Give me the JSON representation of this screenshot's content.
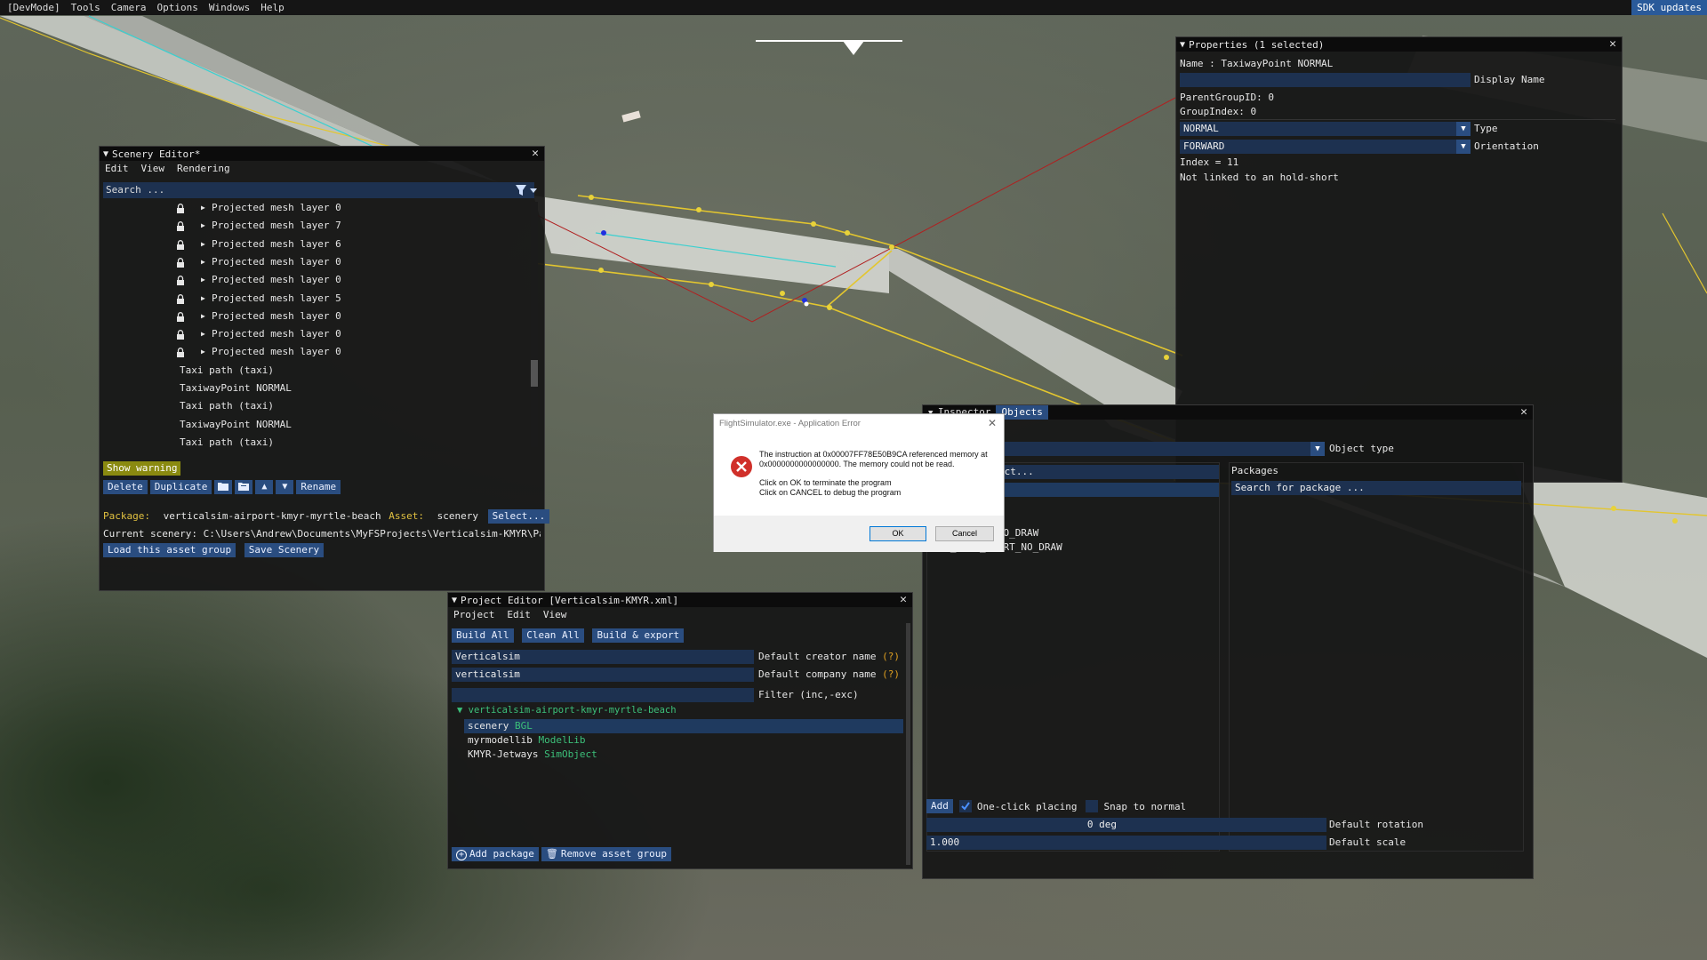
{
  "menubar": {
    "items": [
      "[DevMode]",
      "Tools",
      "Camera",
      "Options",
      "Windows",
      "Help"
    ],
    "sdk_updates": "SDK updates"
  },
  "scenery_editor": {
    "title": "Scenery Editor*",
    "menu": [
      "Edit",
      "View",
      "Rendering"
    ],
    "search_placeholder": "Search ...",
    "items": [
      {
        "label": "Projected mesh layer 0",
        "locked": true,
        "expandable": true
      },
      {
        "label": "Projected mesh layer 7",
        "locked": true,
        "expandable": true
      },
      {
        "label": "Projected mesh layer 6",
        "locked": true,
        "expandable": true
      },
      {
        "label": "Projected mesh layer 0",
        "locked": true,
        "expandable": true
      },
      {
        "label": "Projected mesh layer 0",
        "locked": true,
        "expandable": true
      },
      {
        "label": "Projected mesh layer 5",
        "locked": true,
        "expandable": true
      },
      {
        "label": "Projected mesh layer 0",
        "locked": true,
        "expandable": true
      },
      {
        "label": "Projected mesh layer 0",
        "locked": true,
        "expandable": true
      },
      {
        "label": "Projected mesh layer 0",
        "locked": true,
        "expandable": true
      },
      {
        "label": "Taxi path  (taxi)",
        "locked": false,
        "expandable": false
      },
      {
        "label": "TaxiwayPoint NORMAL",
        "locked": false,
        "expandable": false
      },
      {
        "label": "Taxi path  (taxi)",
        "locked": false,
        "expandable": false
      },
      {
        "label": "TaxiwayPoint NORMAL",
        "locked": false,
        "expandable": false
      },
      {
        "label": "Taxi path  (taxi)",
        "locked": false,
        "expandable": false
      }
    ],
    "show_warning": "Show warning",
    "buttons": {
      "delete": "Delete",
      "duplicate": "Duplicate",
      "rename": "Rename"
    },
    "package_label": "Package:",
    "package_value": "verticalsim-airport-kmyr-myrtle-beach",
    "asset_label": "Asset:",
    "asset_value": "scenery",
    "select_button": "Select...",
    "current_scenery": "Current scenery: C:\\Users\\Andrew\\Documents\\MyFSProjects\\Verticalsim-KMYR\\PackageSo",
    "load_asset_group": "Load this asset group",
    "save_scenery": "Save Scenery"
  },
  "properties": {
    "title": "Properties (1 selected)",
    "name_line": "Name : TaxiwayPoint NORMAL",
    "display_name_label": "Display Name",
    "parent_group": "ParentGroupID: 0",
    "group_index": "GroupIndex: 0",
    "type_value": "NORMAL",
    "type_label": "Type",
    "orientation_value": "FORWARD",
    "orientation_label": "Orientation",
    "index_line": "Index = 11",
    "hold_short_line": "Not linked to an hold-short"
  },
  "objects": {
    "tabs": [
      "Inspector",
      "Objects"
    ],
    "object_type_label": "Object type",
    "packages_header": "Packages",
    "select_placeholder": "ect...",
    "package_search": "Search for package ...",
    "list_items": [
      "HOLD_SHORT_NO_DRAW",
      "ILS_HOLD_SHORT_NO_DRAW"
    ],
    "add_button": "Add",
    "one_click_label": "One-click placing",
    "one_click_checked": true,
    "snap_label": "Snap to normal",
    "snap_checked": false,
    "rotation_value": "0 deg",
    "rotation_label": "Default rotation",
    "scale_value": "1.000",
    "scale_label": "Default scale"
  },
  "project_editor": {
    "title": "Project Editor [Verticalsim-KMYR.xml]",
    "menu": [
      "Project",
      "Edit",
      "View"
    ],
    "buttons": [
      "Build All",
      "Clean All",
      "Build & export"
    ],
    "creator_value": "Verticalsim",
    "creator_label": "Default creator name",
    "company_value": "verticalsim",
    "company_label": "Default company name",
    "help_marker": "(?)",
    "filter_label": "Filter (inc,-exc)",
    "tree_root": "verticalsim-airport-kmyr-myrtle-beach",
    "tree_items": [
      {
        "name": "scenery",
        "type": "BGL",
        "selected": true
      },
      {
        "name": "myrmodellib",
        "type": "ModelLib",
        "selected": false
      },
      {
        "name": "KMYR-Jetways",
        "type": "SimObject",
        "selected": false
      }
    ],
    "add_package": "Add package",
    "remove_asset_group": "Remove asset group"
  },
  "error_dialog": {
    "title": "FlightSimulator.exe - Application Error",
    "line1": "The instruction at 0x00007FF78E50B9CA referenced memory at",
    "line2": "0x0000000000000000. The memory could not be read.",
    "line3": "Click on OK to terminate the program",
    "line4": "Click on CANCEL to debug the program",
    "ok": "OK",
    "cancel": "Cancel"
  },
  "colors": {
    "panel_bg": "#161616",
    "accent_blue": "#2a4d80",
    "warning_yellow": "#8a8a10",
    "package_label": "#e0c040",
    "type_green": "#3cc07a",
    "sdk_blue": "#2a5a9a",
    "error_red": "#d0302a"
  }
}
